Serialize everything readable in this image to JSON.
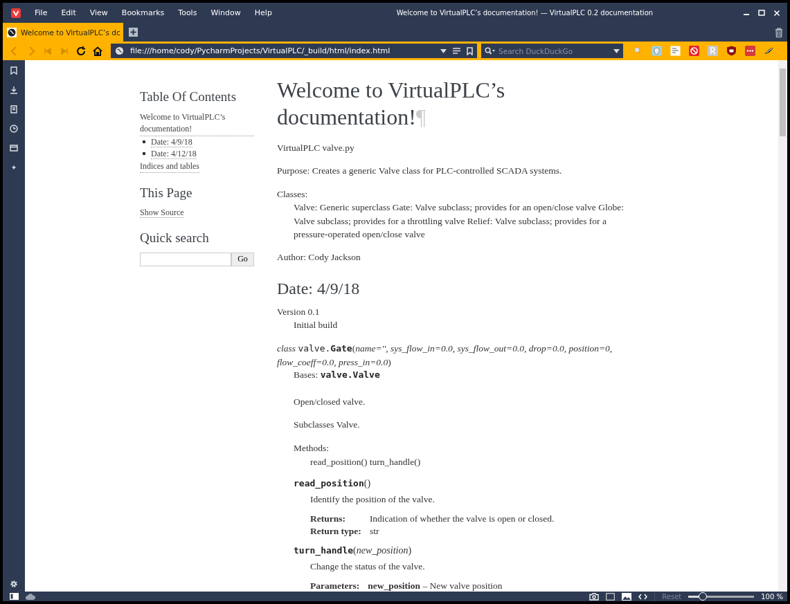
{
  "window": {
    "title": "Welcome to VirtualPLC’s documentation! — VirtualPLC 0.2 documentation"
  },
  "menu": [
    "File",
    "Edit",
    "View",
    "Bookmarks",
    "Tools",
    "Window",
    "Help"
  ],
  "tabs": [
    {
      "label": "Welcome to VirtualPLC’s dc",
      "selected": true
    }
  ],
  "nav_buttons": [
    {
      "kind": "back",
      "disabled": true
    },
    {
      "kind": "forward",
      "disabled": true
    },
    {
      "kind": "rewind",
      "disabled": true
    },
    {
      "kind": "fastforward",
      "disabled": true
    },
    {
      "kind": "reload",
      "disabled": false
    },
    {
      "kind": "home",
      "disabled": false
    }
  ],
  "address": {
    "value": "file:///home/cody/PycharmProjects/VirtualPLC/_build/html/index.html"
  },
  "search": {
    "placeholder": "Search DuckDuckGo"
  },
  "extensions": [
    {
      "kind": "magnifier"
    },
    {
      "kind": "shield"
    },
    {
      "kind": "note"
    },
    {
      "kind": "block"
    },
    {
      "kind": "letter"
    },
    {
      "kind": "badge"
    },
    {
      "kind": "dots"
    },
    {
      "kind": "bird"
    }
  ],
  "toc": {
    "title": "Table Of Contents",
    "items": [
      {
        "label": "Welcome to VirtualPLC’s documentation!",
        "children": [
          {
            "label": "Date: 4/9/18"
          },
          {
            "label": "Date: 4/12/18"
          }
        ]
      },
      {
        "label": "Indices and tables"
      }
    ]
  },
  "this_page": {
    "title": "This Page",
    "link": "Show Source"
  },
  "quick_search": {
    "title": "Quick search",
    "button": "Go"
  },
  "doc": {
    "title": "Welcome to VirtualPLC’s documentation!",
    "pilcrow": "¶",
    "body": [
      {
        "kind": "para",
        "text": "VirtualPLC valve.py"
      },
      {
        "kind": "para",
        "text": "Purpose: Creates a generic Valve class for PLC-controlled SCADA systems."
      },
      {
        "kind": "def",
        "term": "Classes:",
        "desc": "Valve: Generic superclass Gate: Valve subclass; provides for an open/close valve Globe: Valve subclass; provides for a throttling valve Relief: Valve subclass; provides for a pressure-operated open/close valve"
      },
      {
        "kind": "para",
        "text": "Author: Cody Jackson"
      },
      {
        "kind": "heading",
        "text": "Date: 4/9/18"
      },
      {
        "kind": "def",
        "term": "Version 0.1",
        "desc": "Initial build"
      }
    ],
    "class": {
      "prefix": "class",
      "module": "valve.",
      "name": "Gate",
      "params": "(*name='', sys_flow_in=0.0, sys_flow_out=0.0, drop=0.0, position=0, flow_coeff=0.0, press_in=0.0*)",
      "bases_label": "Bases:",
      "bases": "valve.Valve",
      "paras": [
        "Open/closed valve.",
        "Subclasses Valve."
      ],
      "methods_term": "Methods:",
      "methods_desc": "read_position() turn_handle()",
      "methods": [
        {
          "name": "read_position",
          "params": "()",
          "desc": "Identify the position of the valve.",
          "fields": [
            {
              "label": "Returns:",
              "value": "Indication of whether the valve is open or closed."
            },
            {
              "label": "Return type:",
              "value": "str"
            }
          ]
        },
        {
          "name": "turn_handle",
          "params": "(*new_position*)",
          "desc": "Change the status of the valve.",
          "fields": [
            {
              "label": "Parameters:",
              "value": "**new_position** – New valve position"
            }
          ]
        }
      ]
    }
  },
  "status": {
    "reset": "Reset",
    "zoom": {
      "level": 0.22
    },
    "zoom_label": "100 %"
  }
}
